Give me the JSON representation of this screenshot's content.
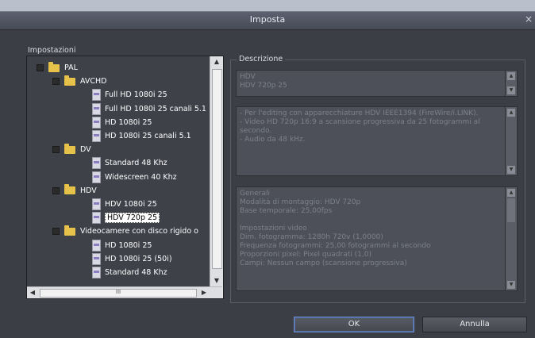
{
  "window": {
    "title": "Imposta",
    "close_glyph": "×"
  },
  "settings": {
    "group_label": "Impostazioni",
    "tree": [
      {
        "type": "folder",
        "label": "PAL",
        "level": 0
      },
      {
        "type": "folder",
        "label": "AVCHD",
        "level": 1
      },
      {
        "type": "file",
        "label": "Full HD 1080i 25",
        "level": 2
      },
      {
        "type": "file",
        "label": "Full HD 1080i 25 canali 5.1",
        "level": 2
      },
      {
        "type": "file",
        "label": "HD 1080i 25",
        "level": 2
      },
      {
        "type": "file",
        "label": "HD 1080i 25 canali 5.1",
        "level": 2
      },
      {
        "type": "folder",
        "label": "DV",
        "level": 1
      },
      {
        "type": "file",
        "label": "Standard 48 Khz",
        "level": 2
      },
      {
        "type": "file",
        "label": "Widescreen 40 Khz",
        "level": 2
      },
      {
        "type": "folder",
        "label": "HDV",
        "level": 1
      },
      {
        "type": "file",
        "label": "HDV 1080i 25",
        "level": 2
      },
      {
        "type": "file",
        "label": "HDV 720p 25",
        "level": 2,
        "selected": true
      },
      {
        "type": "folder",
        "label": "Videocamere con disco rigido o",
        "level": 1
      },
      {
        "type": "file",
        "label": "HD 1080i 25",
        "level": 2
      },
      {
        "type": "file",
        "label": "HD 1080i 25 (50i)",
        "level": 2
      },
      {
        "type": "file",
        "label": "Standard 48 Khz",
        "level": 2
      }
    ],
    "hscroll_label": "III"
  },
  "description": {
    "legend": "Descrizione",
    "name_lines": [
      "HDV",
      "HDV 720p 25"
    ],
    "summary_lines": [
      "- Per l'editing con apparecchiature HDV IEEE1394 (FireWire/i.LINK).",
      "- Video HD 720p 16:9 a scansione progressiva da 25 fotogrammi al",
      "secondo.",
      "- Audio da 48 kHz."
    ],
    "details_lines": [
      "Generali",
      "Modalità di montaggio: HDV 720p",
      "Base temporale: 25,00fps",
      "",
      "Impostazioni video",
      "Dim. fotogramma: 1280h 720v (1,0000)",
      "Frequenza fotogrammi: 25,00 fotogrammi al secondo",
      "Proporzioni pixel: Pixel quadrati (1,0)",
      "Campi: Nessun campo (scansione progressiva)"
    ]
  },
  "buttons": {
    "ok": "OK",
    "cancel": "Annulla"
  }
}
